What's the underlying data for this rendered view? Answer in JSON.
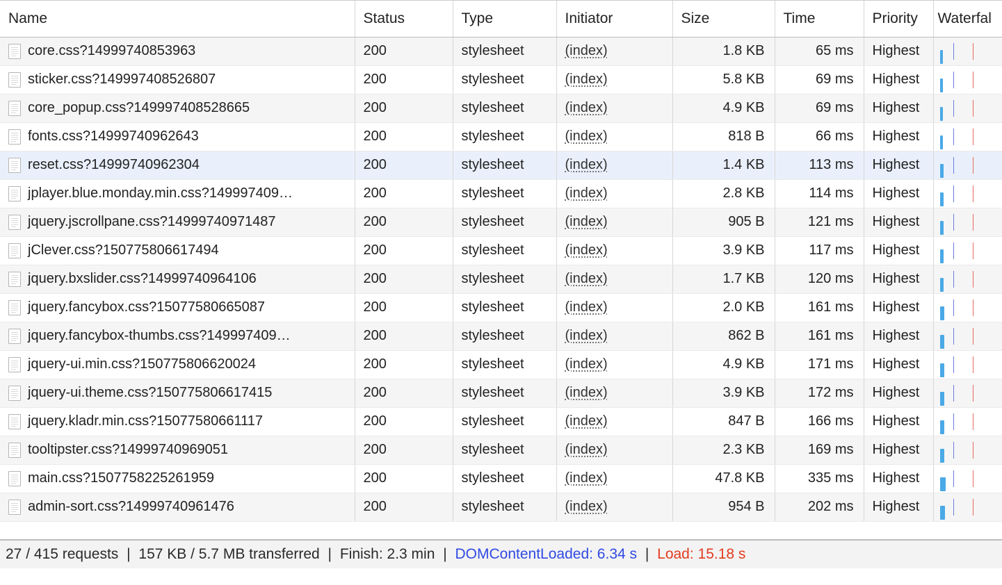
{
  "columns": {
    "name": "Name",
    "status": "Status",
    "type": "Type",
    "initiator": "Initiator",
    "size": "Size",
    "time": "Time",
    "priority": "Priority",
    "waterfall": "Waterfal"
  },
  "selectedRow": 4,
  "waterfall": {
    "dclPos": 22,
    "loadPos": 50
  },
  "rows": [
    {
      "name": "core.css?14999740853963",
      "status": "200",
      "type": "stylesheet",
      "initiator": "(index)",
      "size": "1.8 KB",
      "time": "65 ms",
      "priority": "Highest",
      "barStart": 3,
      "barLen": 4
    },
    {
      "name": "sticker.css?149997408526807",
      "status": "200",
      "type": "stylesheet",
      "initiator": "(index)",
      "size": "5.8 KB",
      "time": "69 ms",
      "priority": "Highest",
      "barStart": 3,
      "barLen": 4
    },
    {
      "name": "core_popup.css?149997408528665",
      "status": "200",
      "type": "stylesheet",
      "initiator": "(index)",
      "size": "4.9 KB",
      "time": "69 ms",
      "priority": "Highest",
      "barStart": 3,
      "barLen": 4
    },
    {
      "name": "fonts.css?14999740962643",
      "status": "200",
      "type": "stylesheet",
      "initiator": "(index)",
      "size": "818 B",
      "time": "66 ms",
      "priority": "Highest",
      "barStart": 3,
      "barLen": 4
    },
    {
      "name": "reset.css?14999740962304",
      "status": "200",
      "type": "stylesheet",
      "initiator": "(index)",
      "size": "1.4 KB",
      "time": "113 ms",
      "priority": "Highest",
      "barStart": 3,
      "barLen": 5
    },
    {
      "name": "jplayer.blue.monday.min.css?149997409…",
      "status": "200",
      "type": "stylesheet",
      "initiator": "(index)",
      "size": "2.8 KB",
      "time": "114 ms",
      "priority": "Highest",
      "barStart": 3,
      "barLen": 5
    },
    {
      "name": "jquery.jscrollpane.css?14999740971487",
      "status": "200",
      "type": "stylesheet",
      "initiator": "(index)",
      "size": "905 B",
      "time": "121 ms",
      "priority": "Highest",
      "barStart": 3,
      "barLen": 5
    },
    {
      "name": "jClever.css?150775806617494",
      "status": "200",
      "type": "stylesheet",
      "initiator": "(index)",
      "size": "3.9 KB",
      "time": "117 ms",
      "priority": "Highest",
      "barStart": 3,
      "barLen": 5
    },
    {
      "name": "jquery.bxslider.css?14999740964106",
      "status": "200",
      "type": "stylesheet",
      "initiator": "(index)",
      "size": "1.7 KB",
      "time": "120 ms",
      "priority": "Highest",
      "barStart": 3,
      "barLen": 5
    },
    {
      "name": "jquery.fancybox.css?15077580665087",
      "status": "200",
      "type": "stylesheet",
      "initiator": "(index)",
      "size": "2.0 KB",
      "time": "161 ms",
      "priority": "Highest",
      "barStart": 3,
      "barLen": 6
    },
    {
      "name": "jquery.fancybox-thumbs.css?149997409…",
      "status": "200",
      "type": "stylesheet",
      "initiator": "(index)",
      "size": "862 B",
      "time": "161 ms",
      "priority": "Highest",
      "barStart": 3,
      "barLen": 6
    },
    {
      "name": "jquery-ui.min.css?150775806620024",
      "status": "200",
      "type": "stylesheet",
      "initiator": "(index)",
      "size": "4.9 KB",
      "time": "171 ms",
      "priority": "Highest",
      "barStart": 3,
      "barLen": 6
    },
    {
      "name": "jquery-ui.theme.css?150775806617415",
      "status": "200",
      "type": "stylesheet",
      "initiator": "(index)",
      "size": "3.9 KB",
      "time": "172 ms",
      "priority": "Highest",
      "barStart": 3,
      "barLen": 6
    },
    {
      "name": "jquery.kladr.min.css?15077580661117",
      "status": "200",
      "type": "stylesheet",
      "initiator": "(index)",
      "size": "847 B",
      "time": "166 ms",
      "priority": "Highest",
      "barStart": 3,
      "barLen": 6
    },
    {
      "name": "tooltipster.css?14999740969051",
      "status": "200",
      "type": "stylesheet",
      "initiator": "(index)",
      "size": "2.3 KB",
      "time": "169 ms",
      "priority": "Highest",
      "barStart": 3,
      "barLen": 6
    },
    {
      "name": "main.css?1507758225261959",
      "status": "200",
      "type": "stylesheet",
      "initiator": "(index)",
      "size": "47.8 KB",
      "time": "335 ms",
      "priority": "Highest",
      "barStart": 3,
      "barLen": 8
    },
    {
      "name": "admin-sort.css?14999740961476",
      "status": "200",
      "type": "stylesheet",
      "initiator": "(index)",
      "size": "954 B",
      "time": "202 ms",
      "priority": "Highest",
      "barStart": 3,
      "barLen": 7
    }
  ],
  "statusbar": {
    "requests": "27 / 415 requests",
    "transferred": "157 KB / 5.7 MB transferred",
    "finish": "Finish: 2.3 min",
    "dcl": "DOMContentLoaded: 6.34 s",
    "load": "Load: 15.18 s"
  }
}
